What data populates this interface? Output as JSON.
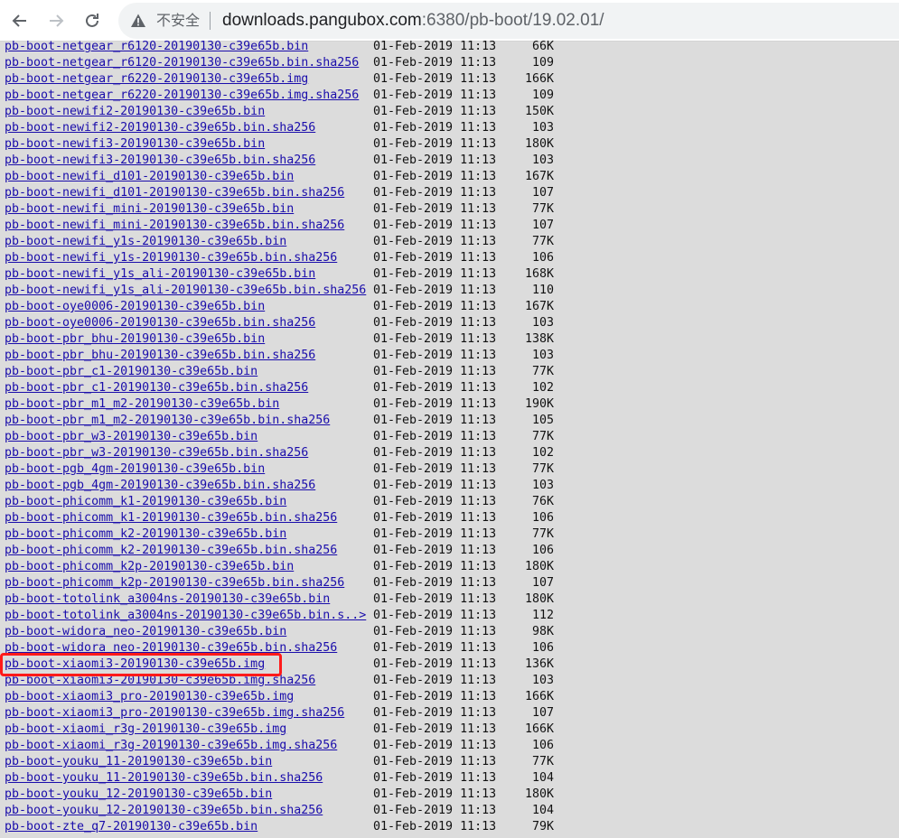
{
  "browser": {
    "security_label": "不安全",
    "url_host": "downloads.pangubox.com",
    "url_rest": ":6380/pb-boot/19.02.01/"
  },
  "files": [
    {
      "name": "pb-boot-netgear_r6120-20190130-c39e65b.bin",
      "date": "01-Feb-2019 11:13",
      "size": "66K"
    },
    {
      "name": "pb-boot-netgear_r6120-20190130-c39e65b.bin.sha256",
      "date": "01-Feb-2019 11:13",
      "size": "109"
    },
    {
      "name": "pb-boot-netgear_r6220-20190130-c39e65b.img",
      "date": "01-Feb-2019 11:13",
      "size": "166K"
    },
    {
      "name": "pb-boot-netgear_r6220-20190130-c39e65b.img.sha256",
      "date": "01-Feb-2019 11:13",
      "size": "109"
    },
    {
      "name": "pb-boot-newifi2-20190130-c39e65b.bin",
      "date": "01-Feb-2019 11:13",
      "size": "150K"
    },
    {
      "name": "pb-boot-newifi2-20190130-c39e65b.bin.sha256",
      "date": "01-Feb-2019 11:13",
      "size": "103"
    },
    {
      "name": "pb-boot-newifi3-20190130-c39e65b.bin",
      "date": "01-Feb-2019 11:13",
      "size": "180K"
    },
    {
      "name": "pb-boot-newifi3-20190130-c39e65b.bin.sha256",
      "date": "01-Feb-2019 11:13",
      "size": "103"
    },
    {
      "name": "pb-boot-newifi_d101-20190130-c39e65b.bin",
      "date": "01-Feb-2019 11:13",
      "size": "167K"
    },
    {
      "name": "pb-boot-newifi_d101-20190130-c39e65b.bin.sha256",
      "date": "01-Feb-2019 11:13",
      "size": "107"
    },
    {
      "name": "pb-boot-newifi_mini-20190130-c39e65b.bin",
      "date": "01-Feb-2019 11:13",
      "size": "77K"
    },
    {
      "name": "pb-boot-newifi_mini-20190130-c39e65b.bin.sha256",
      "date": "01-Feb-2019 11:13",
      "size": "107"
    },
    {
      "name": "pb-boot-newifi_y1s-20190130-c39e65b.bin",
      "date": "01-Feb-2019 11:13",
      "size": "77K"
    },
    {
      "name": "pb-boot-newifi_y1s-20190130-c39e65b.bin.sha256",
      "date": "01-Feb-2019 11:13",
      "size": "106"
    },
    {
      "name": "pb-boot-newifi_y1s_ali-20190130-c39e65b.bin",
      "date": "01-Feb-2019 11:13",
      "size": "168K"
    },
    {
      "name": "pb-boot-newifi_y1s_ali-20190130-c39e65b.bin.sha256",
      "date": "01-Feb-2019 11:13",
      "size": "110"
    },
    {
      "name": "pb-boot-oye0006-20190130-c39e65b.bin",
      "date": "01-Feb-2019 11:13",
      "size": "167K"
    },
    {
      "name": "pb-boot-oye0006-20190130-c39e65b.bin.sha256",
      "date": "01-Feb-2019 11:13",
      "size": "103"
    },
    {
      "name": "pb-boot-pbr_bhu-20190130-c39e65b.bin",
      "date": "01-Feb-2019 11:13",
      "size": "138K"
    },
    {
      "name": "pb-boot-pbr_bhu-20190130-c39e65b.bin.sha256",
      "date": "01-Feb-2019 11:13",
      "size": "103"
    },
    {
      "name": "pb-boot-pbr_c1-20190130-c39e65b.bin",
      "date": "01-Feb-2019 11:13",
      "size": "77K"
    },
    {
      "name": "pb-boot-pbr_c1-20190130-c39e65b.bin.sha256",
      "date": "01-Feb-2019 11:13",
      "size": "102"
    },
    {
      "name": "pb-boot-pbr_m1_m2-20190130-c39e65b.bin",
      "date": "01-Feb-2019 11:13",
      "size": "190K"
    },
    {
      "name": "pb-boot-pbr_m1_m2-20190130-c39e65b.bin.sha256",
      "date": "01-Feb-2019 11:13",
      "size": "105"
    },
    {
      "name": "pb-boot-pbr_w3-20190130-c39e65b.bin",
      "date": "01-Feb-2019 11:13",
      "size": "77K"
    },
    {
      "name": "pb-boot-pbr_w3-20190130-c39e65b.bin.sha256",
      "date": "01-Feb-2019 11:13",
      "size": "102"
    },
    {
      "name": "pb-boot-pgb_4gm-20190130-c39e65b.bin",
      "date": "01-Feb-2019 11:13",
      "size": "77K"
    },
    {
      "name": "pb-boot-pgb_4gm-20190130-c39e65b.bin.sha256",
      "date": "01-Feb-2019 11:13",
      "size": "103"
    },
    {
      "name": "pb-boot-phicomm_k1-20190130-c39e65b.bin",
      "date": "01-Feb-2019 11:13",
      "size": "76K"
    },
    {
      "name": "pb-boot-phicomm_k1-20190130-c39e65b.bin.sha256",
      "date": "01-Feb-2019 11:13",
      "size": "106"
    },
    {
      "name": "pb-boot-phicomm_k2-20190130-c39e65b.bin",
      "date": "01-Feb-2019 11:13",
      "size": "77K"
    },
    {
      "name": "pb-boot-phicomm_k2-20190130-c39e65b.bin.sha256",
      "date": "01-Feb-2019 11:13",
      "size": "106"
    },
    {
      "name": "pb-boot-phicomm_k2p-20190130-c39e65b.bin",
      "date": "01-Feb-2019 11:13",
      "size": "180K"
    },
    {
      "name": "pb-boot-phicomm_k2p-20190130-c39e65b.bin.sha256",
      "date": "01-Feb-2019 11:13",
      "size": "107"
    },
    {
      "name": "pb-boot-totolink_a3004ns-20190130-c39e65b.bin",
      "date": "01-Feb-2019 11:13",
      "size": "180K"
    },
    {
      "name": "pb-boot-totolink_a3004ns-20190130-c39e65b.bin.s..>",
      "date": "01-Feb-2019 11:13",
      "size": "112"
    },
    {
      "name": "pb-boot-widora_neo-20190130-c39e65b.bin",
      "date": "01-Feb-2019 11:13",
      "size": "98K"
    },
    {
      "name": "pb-boot-widora_neo-20190130-c39e65b.bin.sha256",
      "date": "01-Feb-2019 11:13",
      "size": "106"
    },
    {
      "name": "pb-boot-xiaomi3-20190130-c39e65b.img",
      "date": "01-Feb-2019 11:13",
      "size": "136K"
    },
    {
      "name": "pb-boot-xiaomi3-20190130-c39e65b.img.sha256",
      "date": "01-Feb-2019 11:13",
      "size": "103"
    },
    {
      "name": "pb-boot-xiaomi3_pro-20190130-c39e65b.img",
      "date": "01-Feb-2019 11:13",
      "size": "166K"
    },
    {
      "name": "pb-boot-xiaomi3_pro-20190130-c39e65b.img.sha256",
      "date": "01-Feb-2019 11:13",
      "size": "107"
    },
    {
      "name": "pb-boot-xiaomi_r3g-20190130-c39e65b.img",
      "date": "01-Feb-2019 11:13",
      "size": "166K"
    },
    {
      "name": "pb-boot-xiaomi_r3g-20190130-c39e65b.img.sha256",
      "date": "01-Feb-2019 11:13",
      "size": "106"
    },
    {
      "name": "pb-boot-youku_11-20190130-c39e65b.bin",
      "date": "01-Feb-2019 11:13",
      "size": "77K"
    },
    {
      "name": "pb-boot-youku_11-20190130-c39e65b.bin.sha256",
      "date": "01-Feb-2019 11:13",
      "size": "104"
    },
    {
      "name": "pb-boot-youku_12-20190130-c39e65b.bin",
      "date": "01-Feb-2019 11:13",
      "size": "180K"
    },
    {
      "name": "pb-boot-youku_12-20190130-c39e65b.bin.sha256",
      "date": "01-Feb-2019 11:13",
      "size": "104"
    },
    {
      "name": "pb-boot-zte_q7-20190130-c39e65b.bin",
      "date": "01-Feb-2019 11:13",
      "size": "79K"
    }
  ]
}
